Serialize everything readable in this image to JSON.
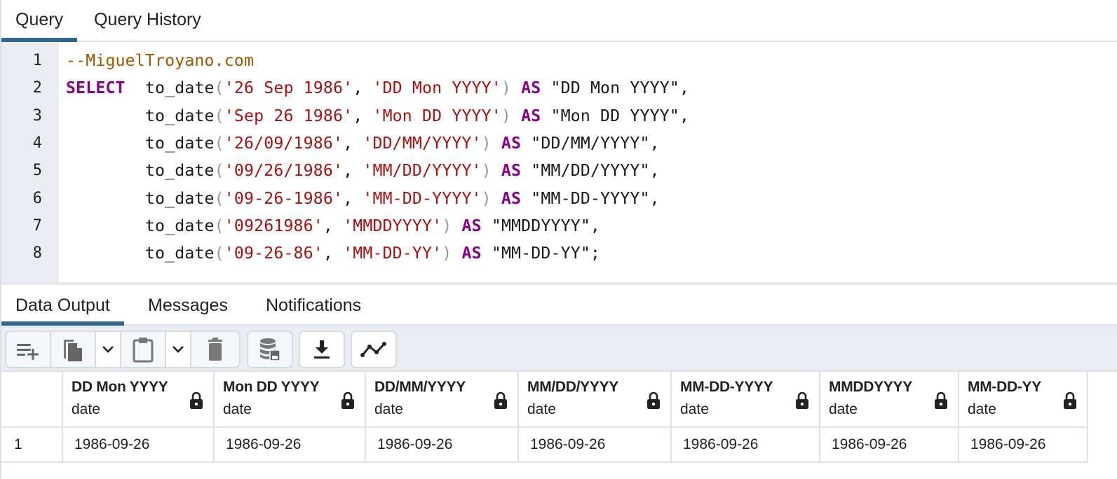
{
  "query_tabs": [
    {
      "label": "Query",
      "active": true
    },
    {
      "label": "Query History",
      "active": false
    }
  ],
  "editor": {
    "line_numbers": [
      "1",
      "2",
      "3",
      "4",
      "5",
      "6",
      "7",
      "8"
    ],
    "lines": [
      [
        {
          "t": "comment",
          "v": "--MiguelTroyano.com"
        }
      ],
      [
        {
          "t": "kw",
          "v": "SELECT"
        },
        {
          "t": "ident",
          "v": "  to_date"
        },
        {
          "t": "paren",
          "v": "("
        },
        {
          "t": "str",
          "v": "'26 Sep 1986'"
        },
        {
          "t": "ident",
          "v": ", "
        },
        {
          "t": "str",
          "v": "'DD Mon YYYY'"
        },
        {
          "t": "paren",
          "v": ")"
        },
        {
          "t": "ident",
          "v": " "
        },
        {
          "t": "kw",
          "v": "AS"
        },
        {
          "t": "ident",
          "v": " \"DD Mon YYYY\","
        }
      ],
      [
        {
          "t": "ident",
          "v": "        to_date"
        },
        {
          "t": "paren",
          "v": "("
        },
        {
          "t": "str",
          "v": "'Sep 26 1986'"
        },
        {
          "t": "ident",
          "v": ", "
        },
        {
          "t": "str",
          "v": "'Mon DD YYYY'"
        },
        {
          "t": "paren",
          "v": ")"
        },
        {
          "t": "ident",
          "v": " "
        },
        {
          "t": "kw",
          "v": "AS"
        },
        {
          "t": "ident",
          "v": " \"Mon DD YYYY\","
        }
      ],
      [
        {
          "t": "ident",
          "v": "        to_date"
        },
        {
          "t": "paren",
          "v": "("
        },
        {
          "t": "str",
          "v": "'26/09/1986'"
        },
        {
          "t": "ident",
          "v": ", "
        },
        {
          "t": "str",
          "v": "'DD/MM/YYYY'"
        },
        {
          "t": "paren",
          "v": ")"
        },
        {
          "t": "ident",
          "v": " "
        },
        {
          "t": "kw",
          "v": "AS"
        },
        {
          "t": "ident",
          "v": " \"DD/MM/YYYY\","
        }
      ],
      [
        {
          "t": "ident",
          "v": "        to_date"
        },
        {
          "t": "paren",
          "v": "("
        },
        {
          "t": "str",
          "v": "'09/26/1986'"
        },
        {
          "t": "ident",
          "v": ", "
        },
        {
          "t": "str",
          "v": "'MM/DD/YYYY'"
        },
        {
          "t": "paren",
          "v": ")"
        },
        {
          "t": "ident",
          "v": " "
        },
        {
          "t": "kw",
          "v": "AS"
        },
        {
          "t": "ident",
          "v": " \"MM/DD/YYYY\","
        }
      ],
      [
        {
          "t": "ident",
          "v": "        to_date"
        },
        {
          "t": "paren",
          "v": "("
        },
        {
          "t": "str",
          "v": "'09-26-1986'"
        },
        {
          "t": "ident",
          "v": ", "
        },
        {
          "t": "str",
          "v": "'MM-DD-YYYY'"
        },
        {
          "t": "paren",
          "v": ")"
        },
        {
          "t": "ident",
          "v": " "
        },
        {
          "t": "kw",
          "v": "AS"
        },
        {
          "t": "ident",
          "v": " \"MM-DD-YYYY\","
        }
      ],
      [
        {
          "t": "ident",
          "v": "        to_date"
        },
        {
          "t": "paren",
          "v": "("
        },
        {
          "t": "str",
          "v": "'09261986'"
        },
        {
          "t": "ident",
          "v": ", "
        },
        {
          "t": "str",
          "v": "'MMDDYYYY'"
        },
        {
          "t": "paren",
          "v": ")"
        },
        {
          "t": "ident",
          "v": " "
        },
        {
          "t": "kw",
          "v": "AS"
        },
        {
          "t": "ident",
          "v": " \"MMDDYYYY\","
        }
      ],
      [
        {
          "t": "ident",
          "v": "        to_date"
        },
        {
          "t": "paren",
          "v": "("
        },
        {
          "t": "str",
          "v": "'09-26-86'"
        },
        {
          "t": "ident",
          "v": ", "
        },
        {
          "t": "str",
          "v": "'MM-DD-YY'"
        },
        {
          "t": "paren",
          "v": ")"
        },
        {
          "t": "ident",
          "v": " "
        },
        {
          "t": "kw",
          "v": "AS"
        },
        {
          "t": "ident",
          "v": " \"MM-DD-YY\";"
        }
      ]
    ]
  },
  "output_tabs": [
    {
      "label": "Data Output",
      "active": true
    },
    {
      "label": "Messages",
      "active": false
    },
    {
      "label": "Notifications",
      "active": false
    }
  ],
  "toolbar": {
    "buttons": [
      {
        "icon": "add-row-icon"
      },
      {
        "icon": "copy-icon"
      },
      {
        "icon": "chevron-down-icon"
      },
      {
        "icon": "paste-icon"
      },
      {
        "icon": "chevron-down-icon"
      },
      {
        "icon": "delete-icon"
      },
      {
        "icon": "save-data-icon"
      },
      {
        "icon": "download-icon"
      },
      {
        "icon": "graph-icon"
      }
    ]
  },
  "grid": {
    "columns": [
      {
        "name": "DD Mon YYYY",
        "type": "date"
      },
      {
        "name": "Mon DD YYYY",
        "type": "date"
      },
      {
        "name": "DD/MM/YYYY",
        "type": "date"
      },
      {
        "name": "MM/DD/YYYY",
        "type": "date"
      },
      {
        "name": "MM-DD-YYYY",
        "type": "date"
      },
      {
        "name": "MMDDYYYY",
        "type": "date"
      },
      {
        "name": "MM-DD-YY",
        "type": "date"
      }
    ],
    "rows": [
      {
        "num": "1",
        "values": [
          "1986-09-26",
          "1986-09-26",
          "1986-09-26",
          "1986-09-26",
          "1986-09-26",
          "1986-09-26",
          "1986-09-26"
        ]
      }
    ]
  },
  "colors": {
    "accent": "#326690",
    "keyword": "#8b008b",
    "string": "#aa1111",
    "comment": "#a55500"
  }
}
